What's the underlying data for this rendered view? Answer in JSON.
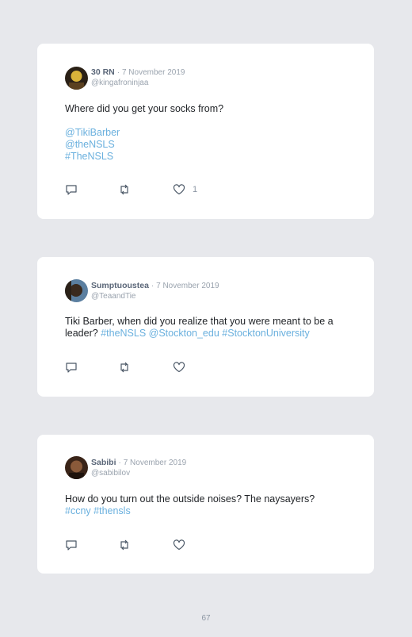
{
  "tweets": [
    {
      "name": "30 RN",
      "separator": "·",
      "date": "7 November 2019",
      "handle": "@kingafroninjaa",
      "text": "Where did you get your socks from?",
      "links": [
        "@TikiBarber",
        "@theNSLS",
        "#TheNSLS"
      ],
      "like_count": "1",
      "avatar_colors": {
        "bg": "#2a2016",
        "accent": "#d8b23a"
      }
    },
    {
      "name": "Sumptuoustea",
      "separator": "·",
      "date": "7 November 2019",
      "handle": "@TeaandTie",
      "text": "Tiki Barber, when did you realize that you were meant to be a leader?",
      "links": [
        "#theNSLS",
        "@Stockton_edu",
        "#StocktonUniversity"
      ],
      "like_count": "",
      "avatar_colors": {
        "bg": "#5b7fa0",
        "accent": "#2b2118"
      }
    },
    {
      "name": "Sabibi",
      "separator": "·",
      "date": "7 November 2019",
      "handle": "@sabibilov",
      "text": "How do you turn out the outside noises? The naysayers?",
      "links": [
        "#ccny",
        "#thensls"
      ],
      "like_count": "",
      "avatar_colors": {
        "bg": "#3a2418",
        "accent": "#8a5a3a"
      }
    }
  ],
  "icons": {
    "reply": "reply-icon",
    "retweet": "retweet-icon",
    "like": "heart-icon"
  },
  "colors": {
    "link": "#6ab0de",
    "card": "#ffffff",
    "page": "#e7e8ec"
  },
  "page_number": "67"
}
